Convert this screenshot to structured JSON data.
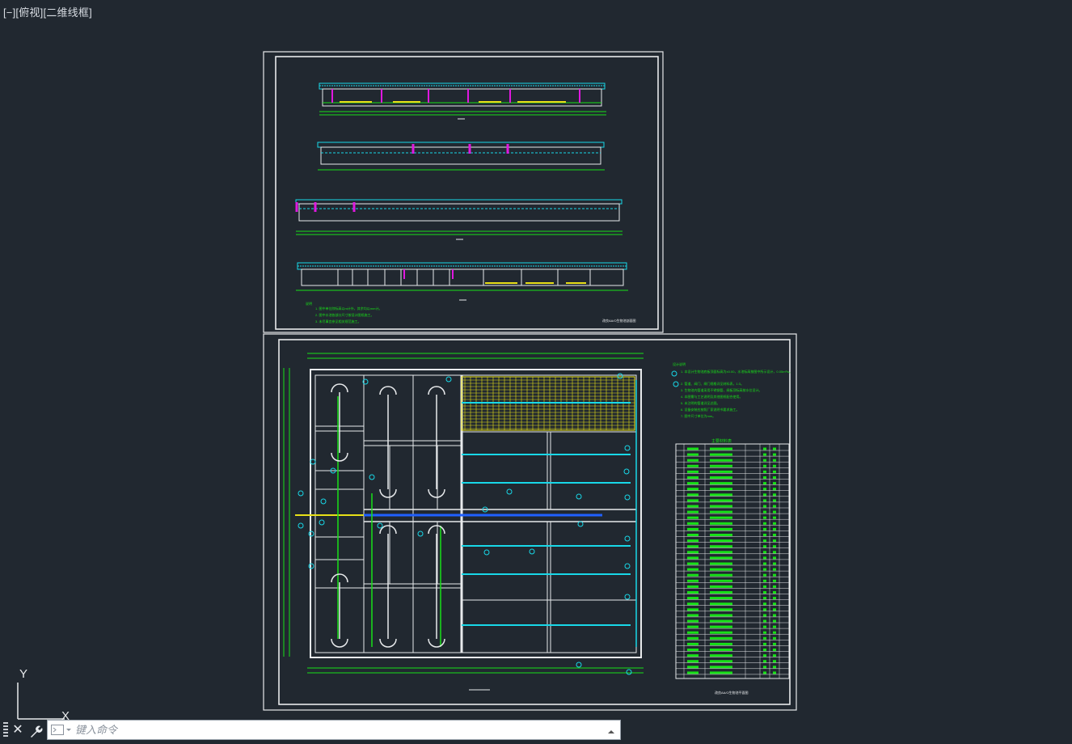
{
  "viewport": {
    "label_parts": [
      "[−]",
      "[俯视]",
      "[二维线框]"
    ]
  },
  "ucs": {
    "y_label": "Y",
    "x_label": "X"
  },
  "command_line": {
    "placeholder": "键入命令"
  },
  "sheets": {
    "sheet1": {
      "notes_lines": [
        "1. 图中单位除标高以m计外，其余均以mm计。",
        "2. 图中水池各部分尺寸按设计图纸施工。",
        "3. 未尽事宜参见相关规范施工。"
      ],
      "title_label": "改良AA/O生物池剖面图"
    },
    "sheet2": {
      "notes_lines": [
        "1. 本设计生物池底板顶面标高为±0.00，水池标高按图中所示设计，0.05m³/s。",
        "2. 管道、阀门、闸门规格详见材料表，1:3。",
        "3. 生物池内管道采用不锈钢管，闸板顶标高按水位设计。",
        "4. 本图需与工艺说明及其他图纸配合使用。",
        "5. 未注明的管道详见总图。",
        "6. 设备安装应按照厂家说明书要求施工。",
        "7. 图中尺寸单位为mm。"
      ],
      "table_title": "主要材料表",
      "title_label": "改良AA/O生物池平面图"
    }
  },
  "colors": {
    "background": "#212830",
    "sheet_border": "#e8eaec",
    "wall": "#e8eaec",
    "pipe_green": "#18e018",
    "pipe_cyan": "#18d8e8",
    "accent_magenta": "#e018e0",
    "accent_yellow": "#e8e018",
    "accent_blue": "#2060ff"
  }
}
